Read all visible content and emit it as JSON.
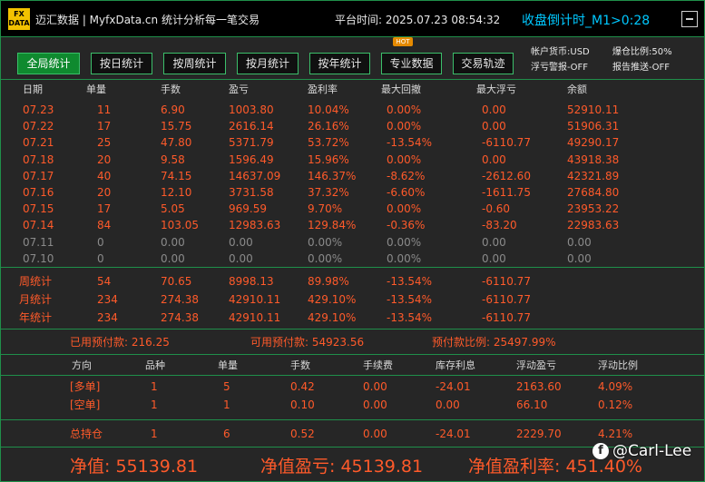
{
  "header": {
    "logo_text": "FX DATA",
    "title": "迈汇数据 | MyfxData.cn   统计分析每一笔交易",
    "platform_time": "平台时间: 2025.07.23 08:54:32",
    "countdown": "收盘倒计时_M1>0:28"
  },
  "tabs": [
    "全局统计",
    "按日统计",
    "按周统计",
    "按月统计",
    "按年统计",
    "专业数据",
    "交易轨迹"
  ],
  "hot_badge": "HOT",
  "settings": {
    "currency": "帐户货币:USD",
    "float_alert": "浮亏警报-OFF",
    "risk_ratio": "爆仓比例:50%",
    "report_push": "报告推送-OFF"
  },
  "daily_table": {
    "headers": [
      "日期",
      "单量",
      "手数",
      "盈亏",
      "盈利率",
      "最大回撤",
      "最大浮亏",
      "余额"
    ],
    "rows": [
      [
        "07.23",
        "11",
        "6.90",
        "1003.80",
        "10.04%",
        "0.00%",
        "0.00",
        "52910.11"
      ],
      [
        "07.22",
        "17",
        "15.75",
        "2616.14",
        "26.16%",
        "0.00%",
        "0.00",
        "51906.31"
      ],
      [
        "07.21",
        "25",
        "47.80",
        "5371.79",
        "53.72%",
        "-13.54%",
        "-6110.77",
        "49290.17"
      ],
      [
        "07.18",
        "20",
        "9.58",
        "1596.49",
        "15.96%",
        "0.00%",
        "0.00",
        "43918.38"
      ],
      [
        "07.17",
        "40",
        "74.15",
        "14637.09",
        "146.37%",
        "-8.62%",
        "-2612.60",
        "42321.89"
      ],
      [
        "07.16",
        "20",
        "12.10",
        "3731.58",
        "37.32%",
        "-6.60%",
        "-1611.75",
        "27684.80"
      ],
      [
        "07.15",
        "17",
        "5.05",
        "969.59",
        "9.70%",
        "0.00%",
        "-0.60",
        "23953.22"
      ],
      [
        "07.14",
        "84",
        "103.05",
        "12983.63",
        "129.84%",
        "-0.36%",
        "-83.20",
        "22983.63"
      ],
      [
        "07.11",
        "0",
        "0.00",
        "0.00",
        "0.00%",
        "0.00%",
        "0.00",
        "0.00"
      ],
      [
        "07.10",
        "0",
        "0.00",
        "0.00",
        "0.00%",
        "0.00%",
        "0.00",
        "0.00"
      ]
    ]
  },
  "period_table": {
    "rows": [
      [
        "周统计",
        "54",
        "70.65",
        "8998.13",
        "89.98%",
        "-13.54%",
        "-6110.77"
      ],
      [
        "月统计",
        "234",
        "274.38",
        "42910.11",
        "429.10%",
        "-13.54%",
        "-6110.77"
      ],
      [
        "年统计",
        "234",
        "274.38",
        "42910.11",
        "429.10%",
        "-13.54%",
        "-6110.77"
      ]
    ]
  },
  "funds": {
    "used": "已用预付款: 216.25",
    "available": "可用预付款: 54923.56",
    "ratio": "预付款比例: 25497.99%"
  },
  "position_table": {
    "headers": [
      "方向",
      "品种",
      "单量",
      "手数",
      "手续费",
      "库存利息",
      "浮动盈亏",
      "浮动比例"
    ],
    "rows": [
      [
        "[多单]",
        "1",
        "5",
        "0.42",
        "0.00",
        "-24.01",
        "2163.60",
        "4.09%"
      ],
      [
        "[空单]",
        "1",
        "1",
        "0.10",
        "0.00",
        "0.00",
        "66.10",
        "0.12%"
      ]
    ],
    "total": [
      "总持仓",
      "1",
      "6",
      "0.52",
      "0.00",
      "-24.01",
      "2229.70",
      "4.21%"
    ]
  },
  "summary": {
    "equity": "净值: 55139.81",
    "equity_pnl": "净值盈亏: 45139.81",
    "equity_rate": "净值盈利率: 451.40%"
  },
  "watermark": "@Carl-Lee",
  "colors": {
    "accent_green": "#1f8f4a",
    "active_tab": "#0f8a2f",
    "value_red": "#ff5a2a",
    "countdown_blue": "#00c8ff",
    "logo_yellow": "#f2c200"
  }
}
